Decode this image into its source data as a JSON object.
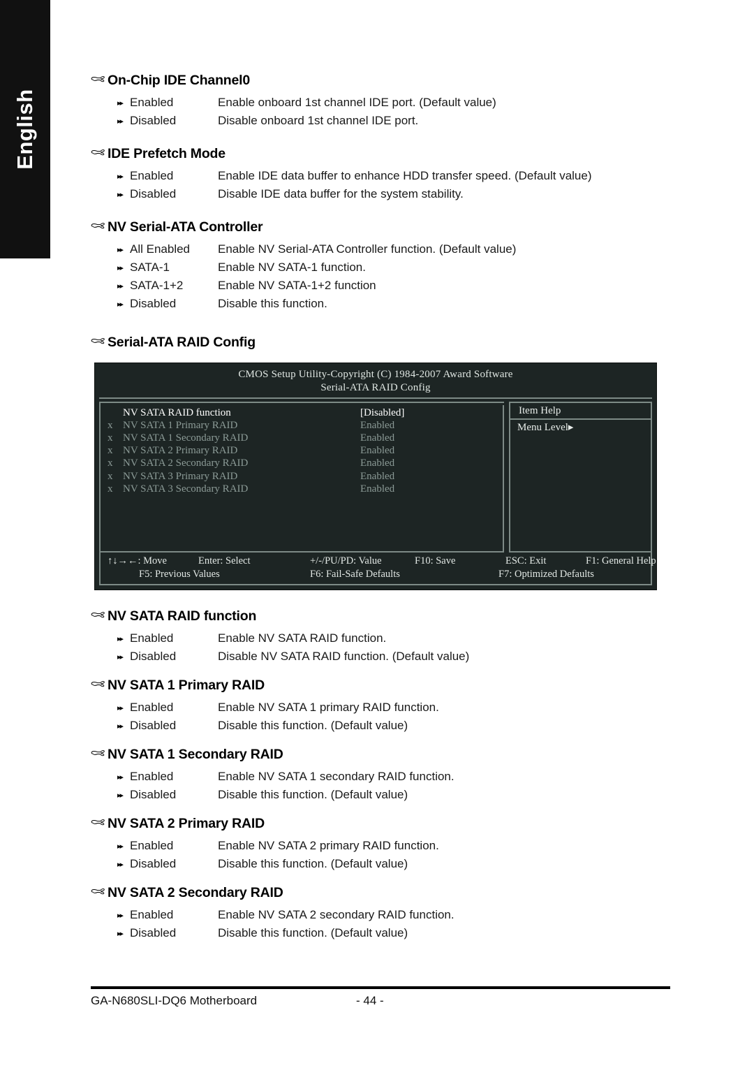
{
  "sidebar": {
    "language": "English"
  },
  "icons": {
    "section_bullet": "pointing-hand",
    "option_bullet": "double-triangle-right"
  },
  "sections": [
    {
      "title": "On-Chip IDE Channel0",
      "options": [
        {
          "label": "Enabled",
          "desc": "Enable onboard 1st channel IDE port. (Default value)"
        },
        {
          "label": "Disabled",
          "desc": "Disable onboard 1st channel IDE port."
        }
      ]
    },
    {
      "title": "IDE Prefetch Mode",
      "options": [
        {
          "label": "Enabled",
          "desc": "Enable IDE data buffer to enhance HDD transfer speed. (Default value)"
        },
        {
          "label": "Disabled",
          "desc": "Disable IDE data buffer for the system stability."
        }
      ]
    },
    {
      "title": "NV Serial-ATA Controller",
      "options": [
        {
          "label": "All Enabled",
          "desc": "Enable NV Serial-ATA Controller function. (Default value)"
        },
        {
          "label": "SATA-1",
          "desc": "Enable NV SATA-1 function."
        },
        {
          "label": "SATA-1+2",
          "desc": "Enable NV SATA-1+2 function"
        },
        {
          "label": "Disabled",
          "desc": "Disable this function."
        }
      ]
    },
    {
      "title": "Serial-ATA RAID Config",
      "options": []
    },
    {
      "title": "NV SATA RAID function",
      "options": [
        {
          "label": "Enabled",
          "desc": "Enable NV SATA RAID function."
        },
        {
          "label": "Disabled",
          "desc": "Disable NV SATA RAID function. (Default value)"
        }
      ]
    },
    {
      "title": "NV SATA 1 Primary RAID",
      "options": [
        {
          "label": "Enabled",
          "desc": "Enable NV SATA 1 primary RAID function."
        },
        {
          "label": "Disabled",
          "desc": "Disable this function. (Default value)"
        }
      ]
    },
    {
      "title": "NV SATA 1 Secondary RAID",
      "options": [
        {
          "label": "Enabled",
          "desc": "Enable NV SATA 1 secondary RAID function."
        },
        {
          "label": "Disabled",
          "desc": "Disable this function. (Default value)"
        }
      ]
    },
    {
      "title": "NV SATA 2 Primary RAID",
      "options": [
        {
          "label": "Enabled",
          "desc": "Enable NV SATA 2 primary RAID function."
        },
        {
          "label": "Disabled",
          "desc": "Disable this function. (Default value)"
        }
      ]
    },
    {
      "title": "NV SATA 2 Secondary RAID",
      "options": [
        {
          "label": "Enabled",
          "desc": "Enable NV SATA 2 secondary RAID function."
        },
        {
          "label": "Disabled",
          "desc": "Disable this function. (Default value)"
        }
      ]
    }
  ],
  "bios": {
    "title_line1": "CMOS Setup Utility-Copyright (C) 1984-2007 Award Software",
    "title_line2": "Serial-ATA RAID Config",
    "rows": [
      {
        "x": "",
        "name": "NV SATA RAID function",
        "value": "[Disabled]",
        "state": "active"
      },
      {
        "x": "x",
        "name": "NV SATA 1 Primary RAID",
        "value": "Enabled",
        "state": "dim"
      },
      {
        "x": "x",
        "name": "NV SATA 1 Secondary RAID",
        "value": "Enabled",
        "state": "dim"
      },
      {
        "x": "x",
        "name": "NV SATA 2 Primary RAID",
        "value": "Enabled",
        "state": "dim"
      },
      {
        "x": "x",
        "name": "NV SATA 2 Secondary RAID",
        "value": "Enabled",
        "state": "dim"
      },
      {
        "x": "x",
        "name": "NV SATA 3 Primary RAID",
        "value": "Enabled",
        "state": "dim"
      },
      {
        "x": "x",
        "name": "NV SATA 3 Secondary RAID",
        "value": "Enabled",
        "state": "dim"
      }
    ],
    "help_title": "Item Help",
    "help_body": "Menu Level▸",
    "footer_row1": [
      "↑↓→←: Move",
      "Enter: Select",
      "+/-/PU/PD: Value",
      "F10: Save",
      "ESC: Exit",
      "F1: General Help"
    ],
    "footer_row2": [
      "F5: Previous Values",
      "F6: Fail-Safe Defaults",
      "F7: Optimized Defaults"
    ],
    "colors": {
      "background": "#1d2524",
      "border": "#7d8a86",
      "active_text": "#ffffff",
      "dim_text": "#8b9a96"
    }
  },
  "footer": {
    "product": "GA-N680SLI-DQ6 Motherboard",
    "page": "- 44 -"
  }
}
